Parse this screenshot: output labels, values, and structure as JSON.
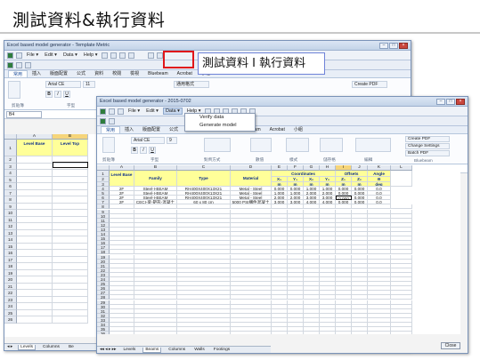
{
  "slide": {
    "title": "測試資料&執行資料"
  },
  "callout": {
    "text": "測試資料 I 執行資料"
  },
  "back_window": {
    "title": "Excel based model generator - Template Metric",
    "menu": [
      "File ▾",
      "Edit ▾",
      "Data ▾",
      "Help ▾"
    ],
    "ribbon_tabs": [
      "常用",
      "插入",
      "版面配置",
      "公式",
      "資料",
      "校閱",
      "檢視",
      "Bluebeam",
      "Acrobat",
      "小組"
    ],
    "font": "Arial CE",
    "size": "11",
    "create_pdf": "Create PDF",
    "general": "通用格式",
    "groups": [
      "剪貼簿",
      "字型"
    ],
    "namebox": "B4",
    "columns": [
      "A",
      "B"
    ],
    "header_row": [
      "Level Base",
      "Level Top"
    ],
    "rows": [
      "1",
      "2",
      "3",
      "4",
      "5",
      "6",
      "7",
      "8",
      "9",
      "10",
      "11",
      "12",
      "13",
      "14",
      "15",
      "16",
      "17",
      "18",
      "19",
      "20",
      "21",
      "22",
      "23",
      "24",
      "25",
      "26"
    ],
    "sheet_tabs": [
      "Levels",
      "Columns",
      "Be"
    ]
  },
  "front_window": {
    "title": "Excel based model generator - 2015-0702",
    "menu": [
      "File ▾",
      "Edit ▾",
      "Data ▾",
      "Help ▾"
    ],
    "dropdown": [
      "Verify data",
      "Generate model"
    ],
    "ribbon_tabs": [
      "常用",
      "插入",
      "版面配置",
      "公式",
      "資料",
      "校閱",
      "檢視",
      "Bluebeam",
      "Acrobat",
      "小組"
    ],
    "font": "Arial CE",
    "size": "9",
    "groups": [
      "剪貼簿",
      "字型",
      "對齊方式",
      "數值",
      "樣式",
      "儲存格",
      "編輯",
      "Bluebeam"
    ],
    "pdf_buttons": [
      "Create PDF",
      "Change Settings",
      "Batch PDF"
    ],
    "namebox": "I6",
    "formula": "0",
    "columns": [
      "A",
      "B",
      "C",
      "D",
      "E",
      "F",
      "G",
      "H",
      "I",
      "J",
      "K",
      "L"
    ],
    "headers": {
      "level_base": "Level Base",
      "family": "Family",
      "type": "Type",
      "material": "Material",
      "coordinates": "Coordinates",
      "offsets": "Offsets",
      "angle": "Angle",
      "sub": [
        "X₁",
        "Y₁",
        "X₂",
        "Y₂",
        "Z₁",
        "Z₂",
        "Θ"
      ],
      "units": [
        "m",
        "m",
        "m",
        "m",
        "m",
        "m",
        "deg"
      ]
    },
    "data_rows": [
      {
        "base": "2F",
        "family": "Steel-I-BEAM",
        "type": "RH400X400X13X21",
        "material": "Metal - Steel",
        "x1": "0.000",
        "y1": "0.000",
        "x2": "1.000",
        "y2": "1.000",
        "z1": "0.000",
        "z2": "0.000",
        "ang": "0.0"
      },
      {
        "base": "2F",
        "family": "Steel-I-BEAM",
        "type": "RH400X400X13X21",
        "material": "Metal - Steel",
        "x1": "1.000",
        "y1": "1.000",
        "x2": "2.000",
        "y2": "2.000",
        "z1": "0.000",
        "z2": "0.000",
        "ang": "0.0"
      },
      {
        "base": "2F",
        "family": "Steel-I-BEAM",
        "type": "RH400X400X13X21",
        "material": "Metal - Steel",
        "x1": "2.000",
        "y1": "2.000",
        "x2": "3.000",
        "y2": "3.000",
        "z1": "0.000",
        "z2": "0.000",
        "ang": "0.0"
      },
      {
        "base": "2F",
        "family": "CECI-梁-矩形-混凝土",
        "type": "60 x 80 cm",
        "material": "5000 PSI構件混凝土",
        "x1": "3.000",
        "y1": "3.000",
        "x2": "4.000",
        "y2": "4.000",
        "z1": "0.000",
        "z2": "0.000",
        "ang": "0.0"
      }
    ],
    "rows": [
      "1",
      "2",
      "3",
      "4",
      "5",
      "6",
      "7",
      "8",
      "9",
      "10",
      "11",
      "12",
      "13",
      "14",
      "15",
      "16",
      "17",
      "18",
      "19",
      "20",
      "21",
      "22",
      "23",
      "24",
      "25",
      "26",
      "27",
      "28",
      "29",
      "30",
      "31",
      "32",
      "33",
      "34",
      "35",
      "36",
      "37",
      "38",
      "39"
    ],
    "sheet_tabs": [
      "Levels",
      "Beams",
      "Columns",
      "Walls",
      "Footings"
    ],
    "close": "Close"
  },
  "colors": {
    "highlight_yellow": "#ffff99",
    "header_text": "#0c2f8a",
    "red_box": "#e0161b",
    "callout_border": "#6e82d8"
  }
}
